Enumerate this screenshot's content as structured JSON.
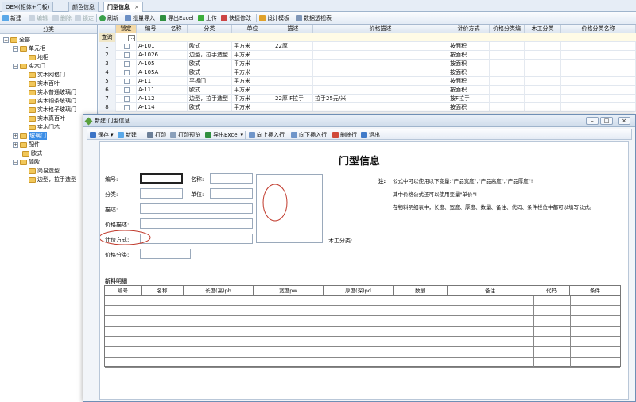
{
  "tabs": [
    {
      "label": "OEM(柜体+门板)"
    },
    {
      "label": "颜色信息"
    },
    {
      "label": "门型信息",
      "close": "×"
    }
  ],
  "toolbar": {
    "new": "新建",
    "edit": "编辑",
    "delete": "删除",
    "lock": "锁定",
    "refresh": "刷新",
    "import": "批量导入",
    "export": "导出Excel",
    "upload": "上传",
    "quick_edit": "快捷修改",
    "design_template": "设计模板",
    "pivot": "数据透视表"
  },
  "tree": {
    "header": "分类",
    "nodes": [
      {
        "label": "全部"
      },
      {
        "label": "单元柜"
      },
      {
        "label": "地柜"
      },
      {
        "label": "实木门"
      },
      {
        "label": "实木网格门"
      },
      {
        "label": "实木百叶"
      },
      {
        "label": "实木普通玻璃门"
      },
      {
        "label": "实木铜条玻璃门"
      },
      {
        "label": "实木格子玻璃门"
      },
      {
        "label": "实木真百叶"
      },
      {
        "label": "实木门芯"
      },
      {
        "label": "玻璃门"
      },
      {
        "label": "配件"
      },
      {
        "label": "欧式"
      },
      {
        "label": "简欧"
      },
      {
        "label": "简易造型"
      },
      {
        "label": "边型，拉手造型"
      }
    ]
  },
  "grid": {
    "columns": [
      "锁定",
      "编号",
      "名称",
      "分类",
      "单位",
      "描述",
      "价格描述",
      "计价方式",
      "价格分类编",
      "木工分类",
      "价格分类名称"
    ],
    "query_label": "查询",
    "query_button": "…",
    "rows": [
      {
        "n": "1",
        "code": "A-101",
        "name": "",
        "cat": "欧式",
        "unit": "平方米",
        "desc": "22厚",
        "pdesc": "",
        "pricing": "按面积"
      },
      {
        "n": "2",
        "code": "A-1026",
        "name": "",
        "cat": "边型，拉手造型",
        "unit": "平方米",
        "desc": "",
        "pdesc": "",
        "pricing": "按面积"
      },
      {
        "n": "3",
        "code": "A-105",
        "name": "",
        "cat": "欧式",
        "unit": "平方米",
        "desc": "",
        "pdesc": "",
        "pricing": "按面积"
      },
      {
        "n": "4",
        "code": "A-105A",
        "name": "",
        "cat": "欧式",
        "unit": "平方米",
        "desc": "",
        "pdesc": "",
        "pricing": "按面积"
      },
      {
        "n": "5",
        "code": "A-11",
        "name": "",
        "cat": "平板门",
        "unit": "平方米",
        "desc": "",
        "pdesc": "",
        "pricing": "按面积"
      },
      {
        "n": "6",
        "code": "A-111",
        "name": "",
        "cat": "欧式",
        "unit": "平方米",
        "desc": "",
        "pdesc": "",
        "pricing": "按面积"
      },
      {
        "n": "7",
        "code": "A-112",
        "name": "",
        "cat": "边型，拉手造型",
        "unit": "平方米",
        "desc": "22厚 F拉手",
        "pdesc": "拉手25元/米",
        "pricing": "按F拉手"
      },
      {
        "n": "8",
        "code": "A-114",
        "name": "",
        "cat": "欧式",
        "unit": "平方米",
        "desc": "",
        "pdesc": "",
        "pricing": "按面积"
      }
    ]
  },
  "dialog": {
    "title": "新建:门型信息",
    "win_min": "–",
    "win_max": "□",
    "win_close": "×",
    "toolbar": {
      "save": "保存",
      "new": "新建",
      "print": "打印",
      "preview": "打印预览",
      "export": "导出Excel",
      "insert_above": "向上插入行",
      "insert_below": "向下插入行",
      "delete_row": "删除行",
      "exit": "退出"
    },
    "form_title": "门型信息",
    "fields": {
      "code": "编号:",
      "name": "名称:",
      "category": "分类:",
      "unit": "单位:",
      "desc": "描述:",
      "price_desc": "价格描述:",
      "pricing": "计价方式:",
      "price_cat": "价格分类:",
      "wood_cat": "木工分类:"
    },
    "notes": {
      "label": "注:",
      "line1": "公式中可以使用以下变量:\"产品宽度\",\"产品高度\",\"产品厚度\"!",
      "line2": "其中价格公式还可以使用变量\"单价\"!",
      "line3": "在物料明细表中，长度、宽度、厚度、数量、备注、代码、条件栏位中都可以填写公式。"
    },
    "materials": {
      "title": "新料明细",
      "columns": [
        "编号",
        "名称",
        "长度(高)ph",
        "宽度pw",
        "厚度(深)pd",
        "数量",
        "备注",
        "代码",
        "条件"
      ]
    },
    "accent": "#c0392b"
  }
}
